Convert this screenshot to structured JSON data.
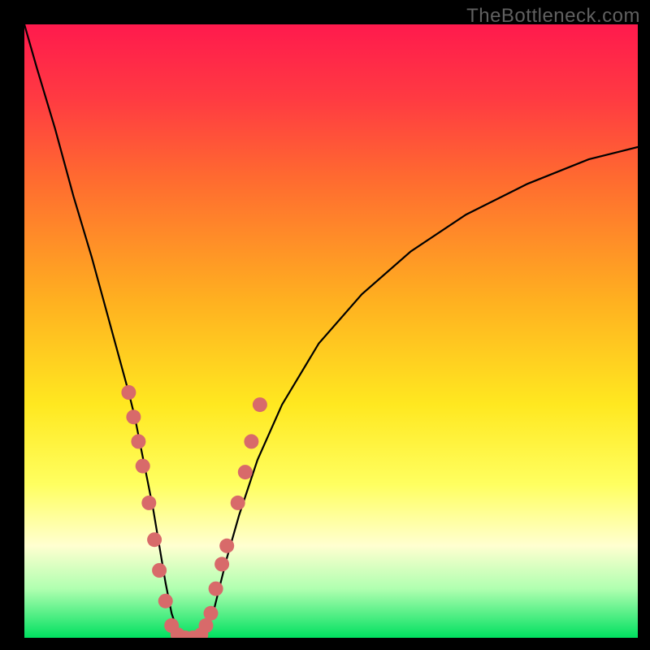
{
  "attribution": "TheBottleneck.com",
  "colors": {
    "gradient_top": "#ff1a4d",
    "gradient_bottom": "#00e060",
    "curve_stroke": "#000000",
    "marker_fill": "#d86a6a",
    "background": "#000000"
  },
  "chart_data": {
    "type": "line",
    "title": "",
    "xlabel": "",
    "ylabel": "",
    "xlim": [
      0,
      100
    ],
    "ylim": [
      0,
      100
    ],
    "grid": false,
    "legend": false,
    "description": "V-shaped bottleneck curve; y represents bottleneck percentage (0 at trough, ~100 at top-left edge, ~80 at right edge). Trough is around x ≈ 24–30 at y = 0.",
    "x": [
      0,
      2,
      5,
      8,
      11,
      14,
      17,
      18,
      19,
      20,
      21,
      22,
      23,
      24,
      25,
      26,
      27,
      28,
      29,
      30,
      31,
      32,
      33,
      35,
      38,
      42,
      48,
      55,
      63,
      72,
      82,
      92,
      100
    ],
    "y": [
      100,
      93,
      83,
      72,
      62,
      51,
      40,
      36,
      31,
      26,
      21,
      15,
      9,
      4,
      1,
      0,
      0,
      0,
      1,
      3,
      5,
      9,
      13,
      20,
      29,
      38,
      48,
      56,
      63,
      69,
      74,
      78,
      80
    ],
    "markers": {
      "comment": "Peach dotted markers clustered near and inside the trough",
      "points": [
        {
          "x": 17.0,
          "y": 40
        },
        {
          "x": 17.8,
          "y": 36
        },
        {
          "x": 18.6,
          "y": 32
        },
        {
          "x": 19.3,
          "y": 28
        },
        {
          "x": 20.3,
          "y": 22
        },
        {
          "x": 21.2,
          "y": 16
        },
        {
          "x": 22.0,
          "y": 11
        },
        {
          "x": 23.0,
          "y": 6
        },
        {
          "x": 24.0,
          "y": 2
        },
        {
          "x": 25.0,
          "y": 0.5
        },
        {
          "x": 26.2,
          "y": 0
        },
        {
          "x": 27.5,
          "y": 0
        },
        {
          "x": 28.8,
          "y": 0.5
        },
        {
          "x": 29.6,
          "y": 2
        },
        {
          "x": 30.4,
          "y": 4
        },
        {
          "x": 31.2,
          "y": 8
        },
        {
          "x": 32.2,
          "y": 12
        },
        {
          "x": 33.0,
          "y": 15
        },
        {
          "x": 34.8,
          "y": 22
        },
        {
          "x": 36.0,
          "y": 27
        },
        {
          "x": 37.0,
          "y": 32
        },
        {
          "x": 38.4,
          "y": 38
        }
      ]
    }
  }
}
